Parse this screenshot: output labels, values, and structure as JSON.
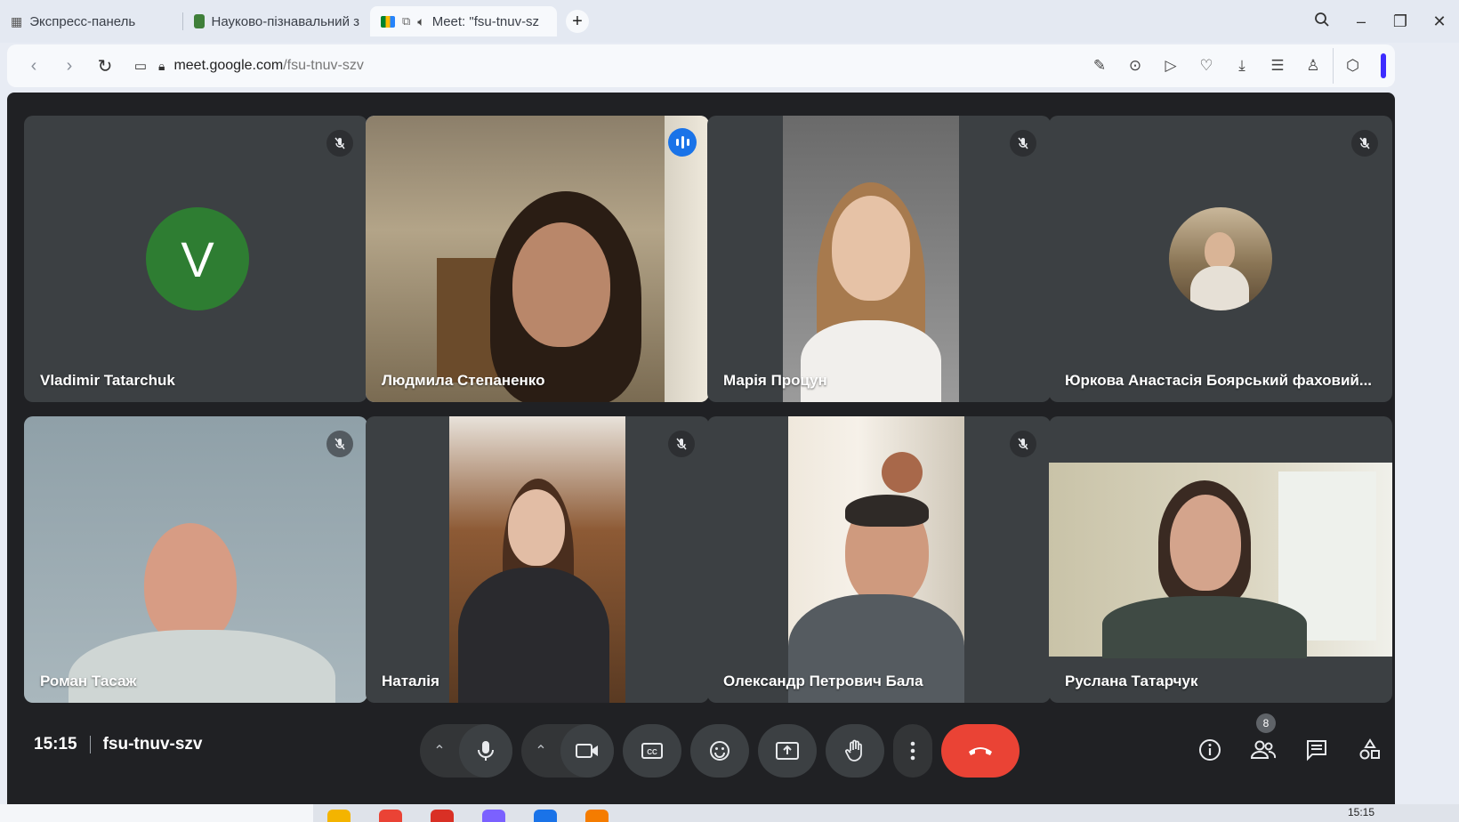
{
  "browser": {
    "tabs": [
      {
        "title": "Экспресс-панель",
        "icon": "grid-icon"
      },
      {
        "title": "Науково-пізнавальний з",
        "icon": "site-favicon"
      },
      {
        "title": "Meet: \"fsu-tnuv-sz",
        "icon": "meet-icon",
        "active": true
      }
    ],
    "url_domain": "meet.google.com",
    "url_path": "/fsu-tnuv-szv"
  },
  "participants": [
    {
      "name": "Vladimir Tatarchuk",
      "muted": true,
      "avatar_letter": "V",
      "avatar_color": "#2e7d32"
    },
    {
      "name": "Людмила Степаненко",
      "muted": false,
      "speaking": true
    },
    {
      "name": "Марія Процун",
      "muted": true
    },
    {
      "name": "Юркова Анастасія Боярський фаховий...",
      "muted": true
    },
    {
      "name": "Роман Тасаж",
      "muted": true
    },
    {
      "name": "Наталія",
      "muted": true
    },
    {
      "name": "Олександр Петрович Бала",
      "muted": true
    },
    {
      "name": "Руслана Татарчук",
      "muted": false
    }
  ],
  "meeting": {
    "time": "15:15",
    "code": "fsu-tnuv-szv",
    "participant_count": "8"
  },
  "taskbar": {
    "time": "15:15"
  },
  "colors": {
    "hangup": "#ea4335",
    "speaking": "#1a73e8",
    "tile": "#3c4043",
    "background": "#202124"
  }
}
